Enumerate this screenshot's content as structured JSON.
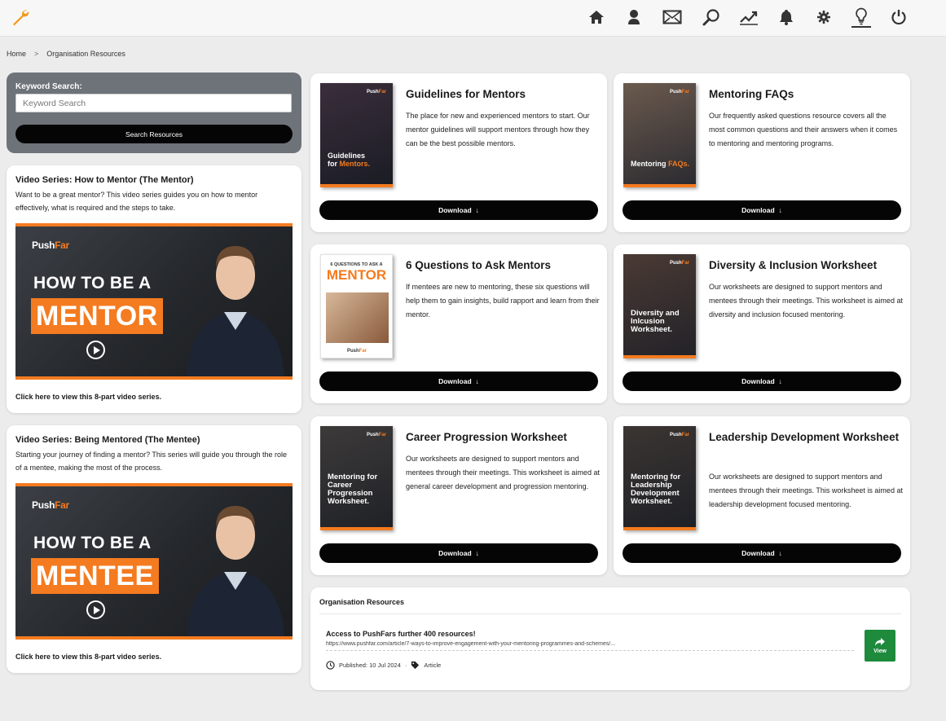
{
  "app": {
    "accent": "#f47b20",
    "success": "#1e8a3c"
  },
  "nav": {
    "icons": [
      "home-icon",
      "profile-icon",
      "mail-icon",
      "search-icon",
      "chart-icon",
      "bell-icon",
      "gear-icon",
      "lightbulb-icon",
      "power-icon"
    ],
    "active": "lightbulb-icon"
  },
  "breadcrumb": {
    "home": "Home",
    "separator": ">",
    "current": "Organisation Resources"
  },
  "search": {
    "label": "Keyword Search:",
    "placeholder": "Keyword Search",
    "button": "Search Resources"
  },
  "videos": [
    {
      "title": "Video Series: How to Mentor (The Mentor)",
      "description": "Want to be a great mentor? This video series guides you on how to mentor effectively, what is required and the steps to take.",
      "thumb_brand_a": "Push",
      "thumb_brand_b": "Far",
      "thumb_line1": "HOW TO BE A",
      "thumb_line2": "MENTOR",
      "link": "Click here to view this 8-part video series."
    },
    {
      "title": "Video Series: Being Mentored (The Mentee)",
      "description": "Starting your journey of finding a mentor? This series will guide you through the role of a mentee, making the most of the process.",
      "thumb_brand_a": "Push",
      "thumb_brand_b": "Far",
      "thumb_line1": "HOW TO BE A",
      "thumb_line2": "MENTEE",
      "link": "Click here to view this 8-part video series."
    }
  ],
  "resources": [
    {
      "title": "Guidelines for Mentors",
      "description": "The place for new and experienced mentors to start. Our mentor guidelines will support mentors through how they can be the best possible mentors.",
      "cover_a": "Guidelines",
      "cover_b": "for ",
      "cover_c": "Mentors.",
      "button": "Download"
    },
    {
      "title": "Mentoring FAQs",
      "description": "Our frequently asked questions resource covers all the most common questions and their answers when it comes to mentoring and mentoring programs.",
      "cover_a": "Mentoring ",
      "cover_c": "FAQs.",
      "button": "Download"
    },
    {
      "title": "6 Questions to Ask Mentors",
      "description": "If mentees are new to mentoring, these six questions will help them to gain insights, build rapport and learn from their mentor.",
      "cover_top": "6 QUESTIONS TO ASK A",
      "cover_big": "MENTOR",
      "button": "Download"
    },
    {
      "title": "Diversity & Inclusion Worksheet",
      "description": "Our worksheets are designed to support mentors and mentees through their meetings. This worksheet is aimed at diversity and inclusion focused mentoring.",
      "cover_a": "Diversity and Inlcusion Worksheet.",
      "button": "Download"
    },
    {
      "title": "Career Progression Worksheet",
      "description": "Our worksheets are designed to support mentors and mentees through their meetings. This worksheet is aimed at general career development and progression mentoring.",
      "cover_a": "Mentoring for Career Progression Worksheet.",
      "button": "Download"
    },
    {
      "title": "Leadership Development Worksheet",
      "description": "Our worksheets are designed to support mentors and mentees through their meetings. This worksheet is aimed at leadership development focused mentoring.",
      "cover_a": "Mentoring for Leadership Development Worksheet.",
      "button": "Download"
    }
  ],
  "org": {
    "heading": "Organisation Resources",
    "item_title": "Access to PushFars further 400 resources!",
    "item_url": "https://www.pushfar.com/article/7-ways-to-improve-engagement-with-your-mentoring-programmes-and-schemes/...",
    "published": "Published: 10 Jul 2024",
    "dot": "·",
    "type": "Article",
    "view": "View"
  }
}
